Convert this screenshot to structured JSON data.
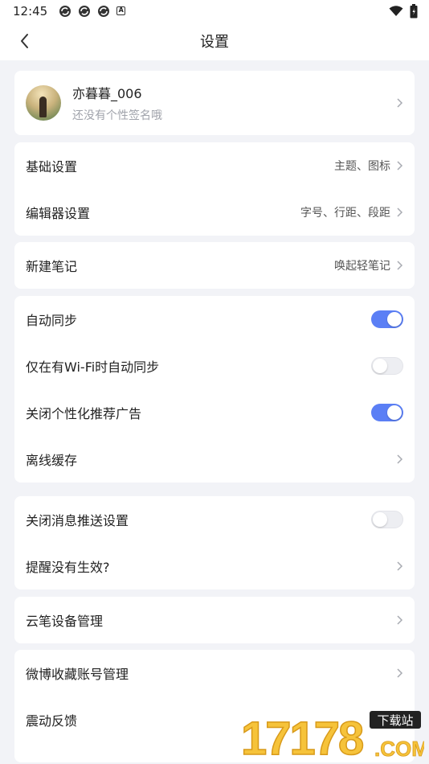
{
  "status_bar": {
    "time": "12:45",
    "icons": [
      "sync-icon",
      "sync-icon",
      "sync-icon",
      "a-icon"
    ],
    "right_icons": [
      "wifi-icon",
      "battery-icon"
    ]
  },
  "header": {
    "title": "设置"
  },
  "profile": {
    "name": "亦暮暮_006",
    "signature": "还没有个性签名哦"
  },
  "basic": {
    "basic_label": "基础设置",
    "basic_value": "主题、图标",
    "editor_label": "编辑器设置",
    "editor_value": "字号、行距、段距"
  },
  "new_note": {
    "label": "新建笔记",
    "value": "唤起轻笔记"
  },
  "sync": {
    "auto_sync_label": "自动同步",
    "auto_sync_on": true,
    "wifi_sync_label": "仅在有Wi-Fi时自动同步",
    "wifi_sync_on": false,
    "ads_label": "关闭个性化推荐广告",
    "ads_on": true,
    "offline_label": "离线缓存"
  },
  "push": {
    "close_push_label": "关闭消息推送设置",
    "close_push_on": false,
    "reminder_label": "提醒没有生效?"
  },
  "pen": {
    "label": "云笔设备管理"
  },
  "misc": {
    "weibo_label": "微博收藏账号管理",
    "vibration_label": "震动反馈",
    "vibration_on": true
  },
  "watermark": {
    "text": "17178",
    "badge": "下载站",
    "domain": ".COM"
  },
  "colors": {
    "accent": "#5b7ff5",
    "background": "#f2f3f7",
    "card": "#ffffff"
  }
}
